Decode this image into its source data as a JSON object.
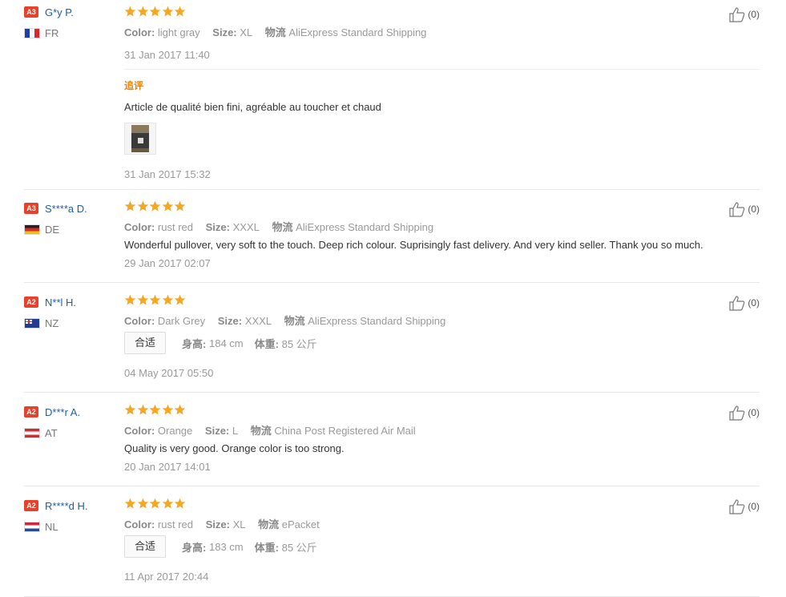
{
  "reviews": [
    {
      "badge": "A3",
      "user": "G*y P.",
      "country": "FR",
      "flag": "fr",
      "rating": 5,
      "color_label": "Color:",
      "color": "light gray",
      "size_label": "Size:",
      "size": "XL",
      "shipping_label": "物流",
      "shipping": "AliExpress Standard Shipping",
      "date": "31 Jan 2017 11:40",
      "followup_label": "追评",
      "followup_text": "Article de qualité bien fini, agréable au toucher et chaud",
      "followup_date": "31 Jan 2017 15:32",
      "likes": "(0)"
    },
    {
      "badge": "A3",
      "user": "S****a D.",
      "country": "DE",
      "flag": "de",
      "rating": 5,
      "color_label": "Color:",
      "color": "rust red",
      "size_label": "Size:",
      "size": "XXXL",
      "shipping_label": "物流",
      "shipping": "AliExpress Standard Shipping",
      "text": "Wonderful pullover, very soft to the touch. Deep rich colour. Suprisingly fast delivery. And very kind seller. Thank you so much.",
      "date": "29 Jan 2017 02:07",
      "likes": "(0)"
    },
    {
      "badge": "A2",
      "user": "N**l H.",
      "country": "NZ",
      "flag": "nz",
      "rating": 5,
      "color_label": "Color:",
      "color": "Dark Grey",
      "size_label": "Size:",
      "size": "XXXL",
      "shipping_label": "物流",
      "shipping": "AliExpress Standard Shipping",
      "fit": "合适",
      "height_label": "身高:",
      "height": "184 cm",
      "weight_label": "体重:",
      "weight": "85 公斤",
      "date": "04 May 2017 05:50",
      "likes": "(0)"
    },
    {
      "badge": "A2",
      "user": "D***r A.",
      "country": "AT",
      "flag": "at",
      "rating": 5,
      "color_label": "Color:",
      "color": "Orange",
      "size_label": "Size:",
      "size": "L",
      "shipping_label": "物流",
      "shipping": "China Post Registered Air Mail",
      "text": "Quality is very good. Orange color is too strong.",
      "date": "20 Jan 2017 14:01",
      "likes": "(0)"
    },
    {
      "badge": "A2",
      "user": "R****d H.",
      "country": "NL",
      "flag": "nl",
      "rating": 5,
      "color_label": "Color:",
      "color": "rust red",
      "size_label": "Size:",
      "size": "XL",
      "shipping_label": "物流",
      "shipping": "ePacket",
      "fit": "合适",
      "height_label": "身高:",
      "height": "183 cm",
      "weight_label": "体重:",
      "weight": "85 公斤",
      "date": "11 Apr 2017 20:44",
      "likes": "(0)"
    }
  ],
  "colors": {
    "star": "#f5a623",
    "badge": "#e5412c",
    "username": "#1c5ea6",
    "followup": "#f08200"
  }
}
